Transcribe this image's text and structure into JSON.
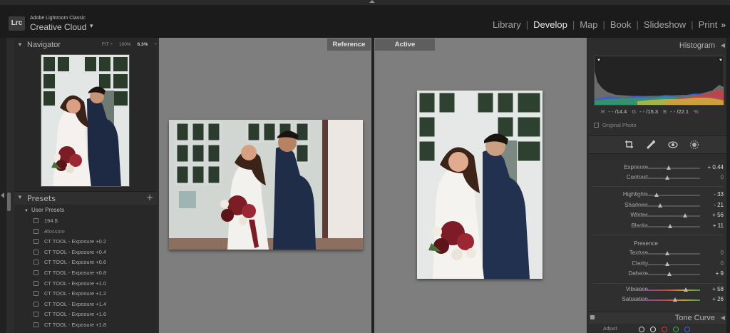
{
  "app": {
    "logo_text": "Lrc",
    "brand_small": "Adobe Lightroom Classic",
    "brand_big": "Creative Cloud"
  },
  "modules": [
    {
      "label": "Library",
      "active": false
    },
    {
      "label": "Develop",
      "active": true
    },
    {
      "label": "Map",
      "active": false
    },
    {
      "label": "Book",
      "active": false
    },
    {
      "label": "Slideshow",
      "active": false
    },
    {
      "label": "Print",
      "active": false
    }
  ],
  "modules_more": "»",
  "navigator": {
    "title": "Navigator",
    "zoom_fit": "FIT ÷",
    "zoom_100": "100%",
    "zoom_current": "6.3%",
    "zoom_more": "÷"
  },
  "presets": {
    "title": "Presets",
    "add": "+",
    "group": "User Presets",
    "items": [
      {
        "label": "194 $",
        "italic": false
      },
      {
        "label": "Blossom",
        "italic": true
      },
      {
        "label": "CT TOOL - Exposure +0.2",
        "italic": false
      },
      {
        "label": "CT TOOL - Exposure +0.4",
        "italic": false
      },
      {
        "label": "CT TOOL - Exposure +0.6",
        "italic": false
      },
      {
        "label": "CT TOOL - Exposure +0.8",
        "italic": false
      },
      {
        "label": "CT TOOL - Exposure +1.0",
        "italic": false
      },
      {
        "label": "CT TOOL - Exposure +1.2",
        "italic": false
      },
      {
        "label": "CT TOOL - Exposure +1.4",
        "italic": false
      },
      {
        "label": "CT TOOL - Exposure +1.6",
        "italic": false
      },
      {
        "label": "CT TOOL - Exposure +1.8",
        "italic": false
      }
    ]
  },
  "compare": {
    "reference_label": "Reference",
    "active_label": "Active"
  },
  "histogram": {
    "title": "Histogram",
    "r_label": "R",
    "r_value": "- - /14.4",
    "g_label": "G",
    "g_value": "- - /15.3",
    "b_label": "B",
    "b_value": "- - /22.1",
    "pct": "%",
    "original_photo": "Original Photo"
  },
  "basic": {
    "presence_label": "Presence",
    "sliders": [
      {
        "label": "Exposure",
        "value": "+ 0.44",
        "pos": 0.53
      },
      {
        "label": "Contrast",
        "value": "0",
        "pos": 0.5
      },
      {
        "label": "Highlights",
        "value": "- 33",
        "pos": 0.34
      },
      {
        "label": "Shadows",
        "value": "- 21",
        "pos": 0.4
      },
      {
        "label": "Whites",
        "value": "+ 56",
        "pos": 0.78
      },
      {
        "label": "Blacks",
        "value": "+ 11",
        "pos": 0.55
      },
      {
        "label": "Texture",
        "value": "0",
        "pos": 0.5
      },
      {
        "label": "Clarity",
        "value": "0",
        "pos": 0.5
      },
      {
        "label": "Dehaze",
        "value": "+ 9",
        "pos": 0.54
      },
      {
        "label": "Vibrance",
        "value": "+ 58",
        "pos": 0.79
      },
      {
        "label": "Saturation",
        "value": "+ 26",
        "pos": 0.63
      }
    ]
  },
  "tone_curve": {
    "title": "Tone Curve",
    "adjust": "Adjust"
  },
  "colors": {
    "accent": "#e6e6e6",
    "panel": "#2d2d2d"
  }
}
